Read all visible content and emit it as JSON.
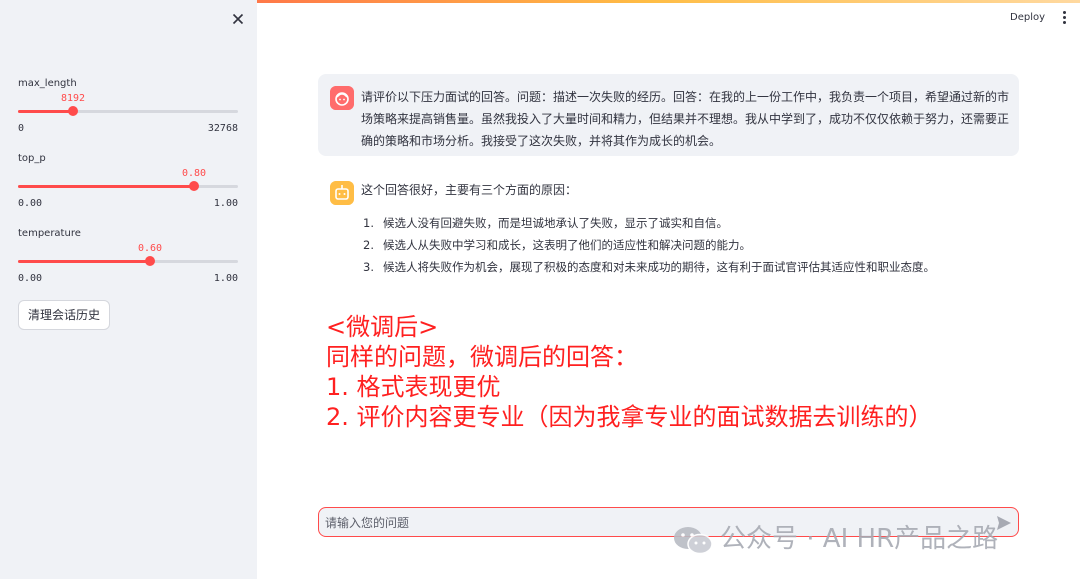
{
  "sidebar": {
    "sliders": [
      {
        "label": "max_length",
        "value": "8192",
        "min": "0",
        "max": "32768",
        "fraction": 0.25
      },
      {
        "label": "top_p",
        "value": "0.80",
        "min": "0.00",
        "max": "1.00",
        "fraction": 0.8
      },
      {
        "label": "temperature",
        "value": "0.60",
        "min": "0.00",
        "max": "1.00",
        "fraction": 0.6
      }
    ],
    "clear_button": "清理会话历史"
  },
  "header": {
    "deploy": "Deploy"
  },
  "chat": {
    "user_message": "请评价以下压力面试的回答。问题：描述一次失败的经历。回答：在我的上一份工作中，我负责一个项目，希望通过新的市场策略来提高销售量。虽然我投入了大量时间和精力，但结果并不理想。我从中学到了，成功不仅仅依赖于努力，还需要正确的策略和市场分析。我接受了这次失败，并将其作为成长的机会。",
    "assistant_intro": "这个回答很好，主要有三个方面的原因：",
    "assistant_points": [
      {
        "num": "1.",
        "text": "候选人没有回避失败，而是坦诚地承认了失败，显示了诚实和自信。"
      },
      {
        "num": "2.",
        "text": "候选人从失败中学习和成长，这表明了他们的适应性和解决问题的能力。"
      },
      {
        "num": "3.",
        "text": "候选人将失败作为机会，展现了积极的态度和对未来成功的期待，这有利于面试官评估其适应性和职业态度。"
      }
    ]
  },
  "annotation": {
    "lines": [
      "<微调后>",
      "同样的问题，微调后的回答：",
      "1. 格式表现更优",
      "2. 评价内容更专业（因为我拿专业的面试数据去训练的）"
    ]
  },
  "input": {
    "placeholder": "请输入您的问题"
  },
  "watermark": {
    "text": "公众号 · AI HR产品之路"
  },
  "colors": {
    "accent": "#ff4b4b",
    "sidebar_bg": "#f0f2f6",
    "annotation": "#ff2020",
    "bot_avatar": "#ffbd45"
  },
  "icons": [
    "close-icon",
    "more-vert-icon",
    "user-avatar-icon",
    "bot-avatar-icon",
    "send-icon",
    "wechat-icon"
  ]
}
